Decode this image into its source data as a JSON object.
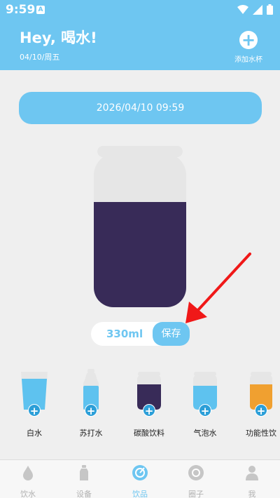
{
  "status_bar": {
    "time": "9:59",
    "app_badge": "A"
  },
  "header": {
    "greeting": "Hey, 喝水!",
    "date": "04/10/周五",
    "add_cup_label": "添加水杯"
  },
  "datetime": "2026/04/10 09:59",
  "bottle": {
    "fill_fraction": 0.68,
    "liquid_color": "#382b58"
  },
  "volume": {
    "value": "330ml",
    "save_label": "保存"
  },
  "drinks": [
    {
      "label": "白水",
      "color": "#5ec2ef"
    },
    {
      "label": "苏打水",
      "color": "#5ec2ef"
    },
    {
      "label": "碳酸饮料",
      "color": "#382b58"
    },
    {
      "label": "气泡水",
      "color": "#5ec2ef"
    },
    {
      "label": "功能性饮",
      "color": "#f0a030"
    }
  ],
  "tabs": [
    {
      "label": "饮水",
      "icon": "water-drop-icon"
    },
    {
      "label": "设备",
      "icon": "bottle-icon"
    },
    {
      "label": "饮品",
      "icon": "drinks-icon",
      "active": true
    },
    {
      "label": "圈子",
      "icon": "circle-icon"
    },
    {
      "label": "我",
      "icon": "person-icon"
    }
  ],
  "colors": {
    "accent": "#6ec6f1",
    "arrow": "#f01818"
  }
}
